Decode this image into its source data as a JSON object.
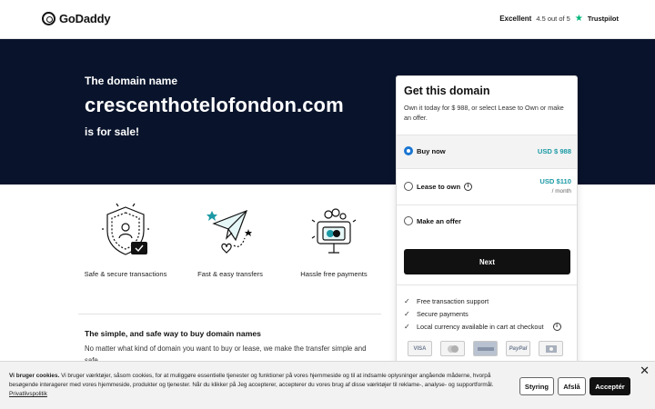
{
  "header": {
    "logo_text": "GoDaddy",
    "trust_excellent": "Excellent",
    "trust_rating": "4.5 out of 5",
    "trust_star": "★",
    "trust_brand": "Trustpilot"
  },
  "hero": {
    "lead": "The domain name",
    "domain": "crescenthotelofondon.com",
    "for_sale": "is for sale!"
  },
  "features": [
    {
      "label": "Safe & secure transactions",
      "icon": "shield-icon"
    },
    {
      "label": "Fast & easy transfers",
      "icon": "paper-plane-icon"
    },
    {
      "label": "Hassle free payments",
      "icon": "wallet-icon"
    }
  ],
  "simple": {
    "title": "The simple, and safe way to buy domain names",
    "body": "No matter what kind of domain you want to buy or lease, we make the transfer simple and safe."
  },
  "panel": {
    "title": "Get this domain",
    "description": "Own it today for $ 988, or select Lease to Own or make an offer.",
    "options": {
      "buy_now": {
        "label": "Buy now",
        "price": "USD $ 988",
        "selected": true
      },
      "lease": {
        "label": "Lease to own",
        "price": "USD $110",
        "sub": "/ month",
        "selected": false
      },
      "offer": {
        "label": "Make an offer",
        "selected": false
      }
    },
    "next_label": "Next",
    "benefits": [
      "Free transaction support",
      "Secure payments",
      "Local currency available in cart at checkout"
    ],
    "payment_methods": [
      "VISA",
      "Mastercard",
      "American Express",
      "PayPal",
      "Bank"
    ],
    "accent_color": "#1b9aa5"
  },
  "cookie": {
    "title": "Vi bruger cookies.",
    "text": "Vi bruger værktøjer, såsom cookies, for at muliggøre essentielle tjenester og funktioner på vores hjemmeside og til at indsamle oplysninger angående måderne, hvorpå besøgende interagerer med vores hjemmeside, produkter og tjenester. Når du klikker på Jeg accepterer, accepterer du vores brug af disse værktøjer til reklame-, analyse- og supportformål.",
    "privacy_link": "Privatlivspolitik",
    "manage_label": "Styring",
    "decline_label": "Afslå",
    "accept_label": "Acceptér",
    "close": "✕"
  }
}
